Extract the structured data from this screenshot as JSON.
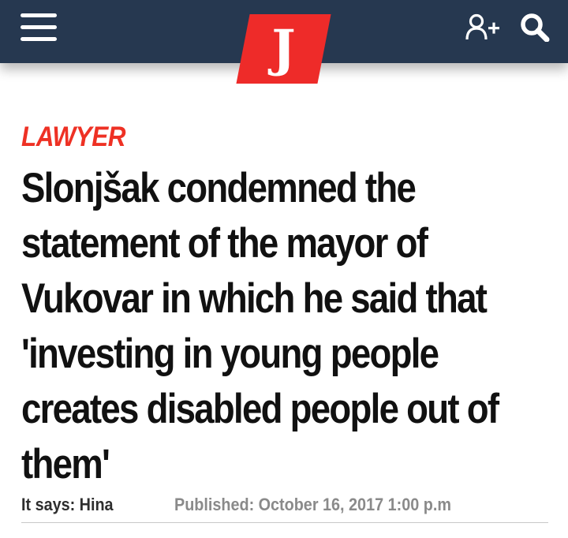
{
  "header": {
    "logo_letter": "J",
    "icons": {
      "menu": "hamburger-menu-icon",
      "user_add": "user-add-icon",
      "search": "search-icon"
    }
  },
  "article": {
    "category": "LAWYER",
    "headline": "Slonjšak condemned the statement of the mayor of Vukovar in which he said that 'investing in young people creates disabled people out of them'",
    "author_label": "It says:",
    "author": "Hina",
    "published_label": "Published:",
    "published_date": "October 16, 2017 1:00 p.m"
  },
  "colors": {
    "topbar": "#263850",
    "logo": "#ee2b29",
    "category": "#ee3124",
    "headline": "#111111",
    "meta_muted": "#8a8a8a"
  }
}
